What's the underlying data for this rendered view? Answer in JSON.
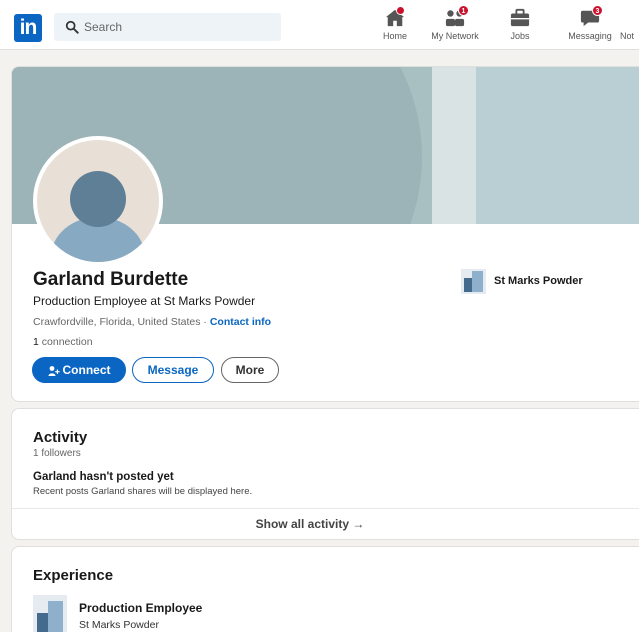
{
  "nav": {
    "logo_text": "in",
    "search_placeholder": "Search",
    "items": [
      {
        "label": "Home",
        "icon": "home-icon",
        "badge": ""
      },
      {
        "label": "My Network",
        "icon": "people-icon",
        "badge": "1"
      },
      {
        "label": "Jobs",
        "icon": "briefcase-icon",
        "badge": ""
      },
      {
        "label": "Messaging",
        "icon": "chat-icon",
        "badge": "3"
      },
      {
        "label": "Not",
        "icon": "bell-icon",
        "badge": ""
      }
    ]
  },
  "colors": {
    "brand": "#0a66c2",
    "notification": "#cb112d",
    "banner": "#a9c0c3",
    "background": "#f4f2ee"
  },
  "profile": {
    "name": "Garland Burdette",
    "headline": "Production Employee at St Marks Powder",
    "location": "Crawfordville, Florida, United States",
    "location_sep": " · ",
    "contact_info": "Contact info",
    "connections_count": "1",
    "connections_label": "connection",
    "buttons": {
      "connect": "Connect",
      "message": "Message",
      "more": "More"
    },
    "current_company": "St Marks Powder"
  },
  "activity": {
    "title": "Activity",
    "followers": "1 followers",
    "empty_title": "Garland hasn't posted yet",
    "empty_subtitle": "Recent posts Garland shares will be displayed here.",
    "show_all": "Show all activity →"
  },
  "experience": {
    "title": "Experience",
    "items": [
      {
        "role": "Production Employee",
        "company": "St Marks Powder"
      }
    ]
  }
}
